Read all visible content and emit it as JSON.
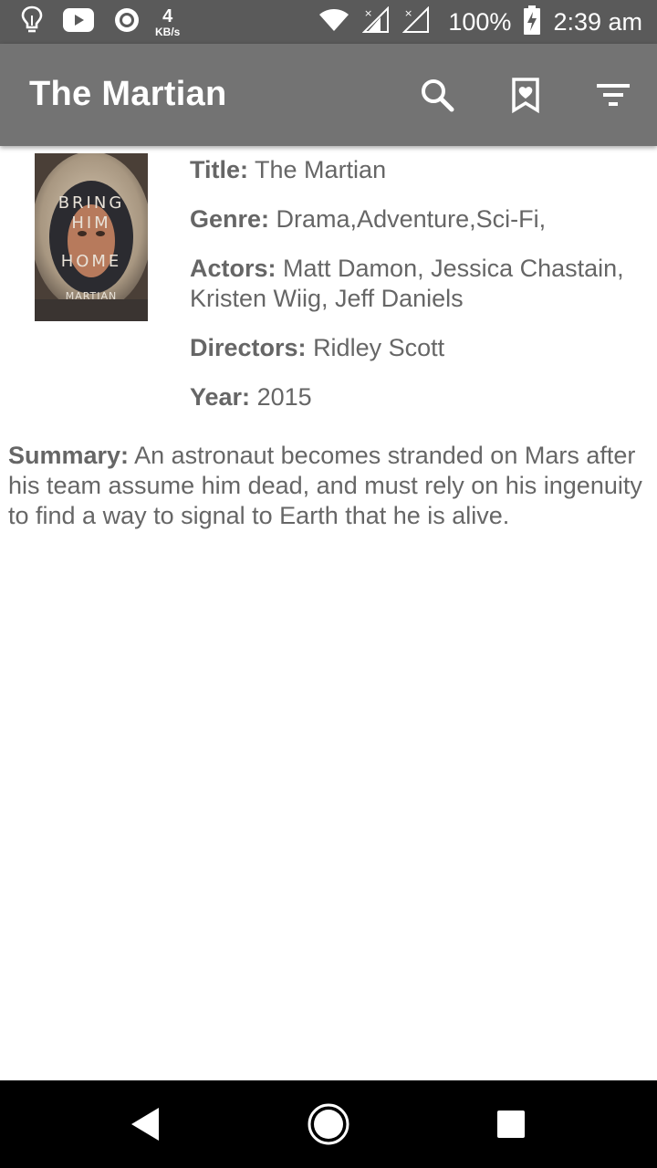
{
  "status_bar": {
    "net_speed_value": "4",
    "net_speed_unit": "KB/s",
    "battery": "100%",
    "time": "2:39 am",
    "icons": [
      "lightbulb-icon",
      "youtube-icon",
      "record-icon",
      "wifi-icon",
      "signal-icon",
      "no-signal-icon",
      "battery-charging-icon"
    ]
  },
  "app_bar": {
    "title": "The Martian",
    "actions": [
      "search-icon",
      "bookmark-heart-icon",
      "filter-icon"
    ]
  },
  "poster": {
    "lines": [
      "BRING",
      "HIM",
      "HOME"
    ],
    "movie_mark": "MARTIAN",
    "colors": {
      "suit": "#c9b9a3",
      "visor": "#2b2b30",
      "face": "#b77a5c"
    }
  },
  "details": {
    "title_label": "Title:",
    "title_value": "The Martian",
    "genre_label": "Genre:",
    "genre_value": "Drama,Adventure,Sci-Fi,",
    "actors_label": "Actors:",
    "actors_value": "Matt Damon, Jessica Chastain, Kristen Wiig, Jeff Daniels",
    "directors_label": "Directors:",
    "directors_value": "Ridley Scott",
    "year_label": "Year:",
    "year_value": "2015"
  },
  "summary": {
    "label": "Summary:",
    "text": "An astronaut becomes stranded on Mars after his team assume him dead, and must rely on his ingenuity to find a way to signal to Earth that he is alive."
  },
  "nav_bar": {
    "buttons": [
      "back-icon",
      "home-icon",
      "recents-icon"
    ]
  },
  "colors": {
    "status_bar": "#5a5a5a",
    "app_bar": "#737373",
    "text": "#666666",
    "nav_bar": "#000000"
  }
}
